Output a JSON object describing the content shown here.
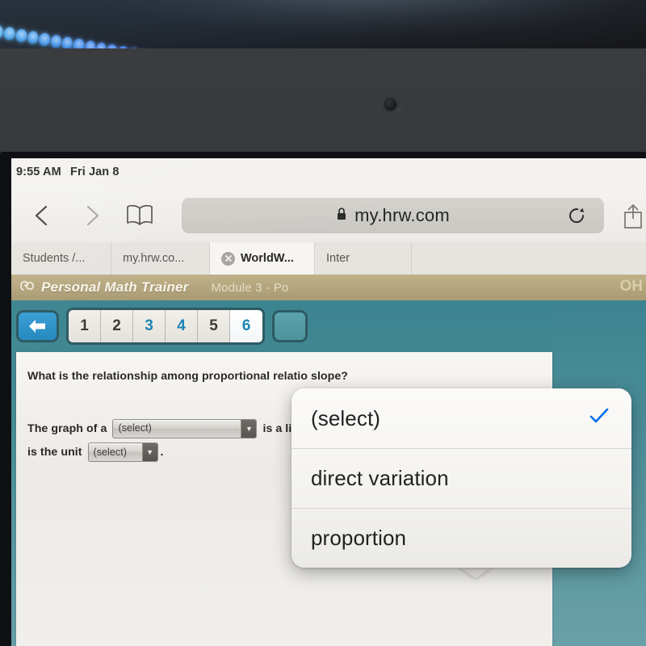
{
  "device": {
    "camera_icon": "camera-dot",
    "led_strip_icon": "led-light-strip"
  },
  "status_bar": {
    "time": "9:55 AM",
    "date": "Fri Jan 8"
  },
  "toolbar": {
    "back_icon": "back-chevron-icon",
    "forward_icon": "forward-chevron-icon",
    "bookmarks_icon": "book-icon",
    "lock_icon": "lock-icon",
    "url": "my.hrw.com",
    "reload_icon": "reload-icon",
    "share_icon": "share-icon"
  },
  "tabs": [
    {
      "label": "Students /...",
      "active": false,
      "closable": false
    },
    {
      "label": "my.hrw.co...",
      "active": false,
      "closable": false
    },
    {
      "label": "WorldW...",
      "active": true,
      "closable": true
    },
    {
      "label": "Inter",
      "active": false,
      "closable": false
    }
  ],
  "app_header": {
    "logo_icon": "pmt-logo-icon",
    "title": "Personal Math Trainer",
    "module": "Module 3 - Po",
    "right_label": "OH"
  },
  "nav": {
    "back_button_icon": "left-arrow-icon",
    "numbers": [
      {
        "label": "1",
        "state": "normal"
      },
      {
        "label": "2",
        "state": "normal"
      },
      {
        "label": "3",
        "state": "visited"
      },
      {
        "label": "4",
        "state": "visited"
      },
      {
        "label": "5",
        "state": "normal"
      },
      {
        "label": "6",
        "state": "current"
      }
    ]
  },
  "question": {
    "prompt": "What is the relationship among proportional relatio           slope?",
    "answer": {
      "lead": "The graph of a",
      "mid": "is a line through the origin whose",
      "tail": "is the unit",
      "end": ".",
      "select_1_value": "(select)",
      "select_2_value": "(select)",
      "select_3_value": "(select)",
      "dropdown_arrow_icon": "chevron-down-icon"
    }
  },
  "picker_popover": {
    "options": [
      {
        "label": "(select)",
        "selected": true
      },
      {
        "label": "direct variation",
        "selected": false
      },
      {
        "label": "proportion",
        "selected": false
      }
    ],
    "check_icon": "checkmark-icon",
    "check_color": "#0a6fe8"
  },
  "colors": {
    "app_teal": "#478c95",
    "header_tan": "#b3a47c",
    "accent_blue": "#2389bf",
    "link_blue": "#1b84b5",
    "check_blue": "#0a6fe8"
  }
}
